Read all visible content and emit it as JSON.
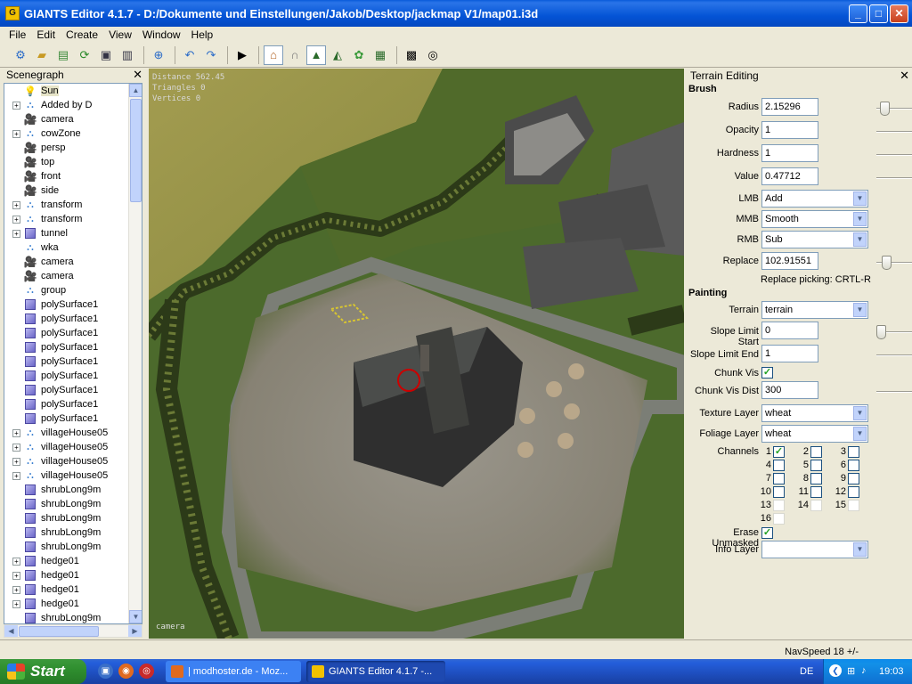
{
  "window": {
    "title": "GIANTS Editor 4.1.7 - D:/Dokumente und Einstellungen/Jakob/Desktop/jackmap V1/map01.i3d",
    "minimize": "_",
    "maximize": "□",
    "close": "✕"
  },
  "menu": [
    "File",
    "Edit",
    "Create",
    "View",
    "Window",
    "Help"
  ],
  "toolbar": {
    "icons": [
      "settings-icon",
      "open-icon",
      "import-icon",
      "refresh-icon",
      "save-icon",
      "export-icon",
      "add-node-icon",
      "undo-icon",
      "redo-icon",
      "play-icon",
      "select-icon",
      "move-icon",
      "terrain-sculpt-icon",
      "terrain-paint-icon",
      "foliage-paint-icon",
      "terrain-info-icon",
      "checker-icon",
      "target-icon"
    ]
  },
  "scenegraph": {
    "title": "Scenegraph",
    "close": "✕",
    "nodes": [
      {
        "label": "Sun",
        "icon": "light",
        "expander": false,
        "selected": true
      },
      {
        "label": "Added by D",
        "icon": "group",
        "expander": true
      },
      {
        "label": "camera",
        "icon": "camera",
        "expander": false
      },
      {
        "label": "cowZone",
        "icon": "group",
        "expander": true
      },
      {
        "label": "persp",
        "icon": "camera",
        "expander": false
      },
      {
        "label": "top",
        "icon": "camera",
        "expander": false
      },
      {
        "label": "front",
        "icon": "camera",
        "expander": false
      },
      {
        "label": "side",
        "icon": "camera",
        "expander": false
      },
      {
        "label": "transform",
        "icon": "group",
        "expander": true
      },
      {
        "label": "transform",
        "icon": "group",
        "expander": true
      },
      {
        "label": "tunnel",
        "icon": "shape",
        "expander": true
      },
      {
        "label": "wka",
        "icon": "group",
        "expander": false
      },
      {
        "label": "camera",
        "icon": "camera",
        "expander": false
      },
      {
        "label": "camera",
        "icon": "camera",
        "expander": false
      },
      {
        "label": "group",
        "icon": "group",
        "expander": false
      },
      {
        "label": "polySurface1",
        "icon": "shape",
        "expander": false
      },
      {
        "label": "polySurface1",
        "icon": "shape",
        "expander": false
      },
      {
        "label": "polySurface1",
        "icon": "shape",
        "expander": false
      },
      {
        "label": "polySurface1",
        "icon": "shape",
        "expander": false
      },
      {
        "label": "polySurface1",
        "icon": "shape",
        "expander": false
      },
      {
        "label": "polySurface1",
        "icon": "shape",
        "expander": false
      },
      {
        "label": "polySurface1",
        "icon": "shape",
        "expander": false
      },
      {
        "label": "polySurface1",
        "icon": "shape",
        "expander": false
      },
      {
        "label": "polySurface1",
        "icon": "shape",
        "expander": false
      },
      {
        "label": "villageHouse05",
        "icon": "group",
        "expander": true
      },
      {
        "label": "villageHouse05",
        "icon": "group",
        "expander": true
      },
      {
        "label": "villageHouse05",
        "icon": "group",
        "expander": true
      },
      {
        "label": "villageHouse05",
        "icon": "group",
        "expander": true
      },
      {
        "label": "shrubLong9m",
        "icon": "shape",
        "expander": false
      },
      {
        "label": "shrubLong9m",
        "icon": "shape",
        "expander": false
      },
      {
        "label": "shrubLong9m",
        "icon": "shape",
        "expander": false
      },
      {
        "label": "shrubLong9m",
        "icon": "shape",
        "expander": false
      },
      {
        "label": "shrubLong9m",
        "icon": "shape",
        "expander": false
      },
      {
        "label": "hedge01",
        "icon": "shape",
        "expander": true
      },
      {
        "label": "hedge01",
        "icon": "shape",
        "expander": true
      },
      {
        "label": "hedge01",
        "icon": "shape",
        "expander": true
      },
      {
        "label": "hedge01",
        "icon": "shape",
        "expander": true
      },
      {
        "label": "shrubLong9m",
        "icon": "shape",
        "expander": false
      }
    ]
  },
  "viewport": {
    "stats": [
      "Distance 562.45",
      "Triangles 0",
      "Vertices 0"
    ],
    "camera_label": "camera"
  },
  "terrain": {
    "title": "Terrain Editing",
    "close": "✕",
    "brush_heading": "Brush",
    "radius_label": "Radius",
    "radius": "2.15296",
    "opacity_label": "Opacity",
    "opacity": "1",
    "hardness_label": "Hardness",
    "hardness": "1",
    "value_label": "Value",
    "value": "0.47712",
    "lmb_label": "LMB",
    "lmb": "Add",
    "mmb_label": "MMB",
    "mmb": "Smooth",
    "rmb_label": "RMB",
    "rmb": "Sub",
    "replace_label": "Replace",
    "replace": "102.91551",
    "replace_picking": "Replace picking: CRTL-R",
    "painting_heading": "Painting",
    "terrain_label": "Terrain",
    "terrain": "terrain",
    "slope_start_label": "Slope Limit Start",
    "slope_start": "0",
    "slope_end_label": "Slope Limit End",
    "slope_end": "1",
    "chunk_vis_label": "Chunk Vis",
    "chunk_vis": true,
    "chunk_vis_dist_label": "Chunk Vis Dist",
    "chunk_vis_dist": "300",
    "texture_layer_label": "Texture Layer",
    "texture_layer": "wheat",
    "foliage_layer_label": "Foliage Layer",
    "foliage_layer": "wheat",
    "channels_label": "Channels",
    "channels": [
      {
        "n": "1",
        "checked": true
      },
      {
        "n": "2",
        "checked": false
      },
      {
        "n": "3",
        "checked": false
      },
      {
        "n": "4",
        "checked": false
      },
      {
        "n": "5",
        "checked": false
      },
      {
        "n": "6",
        "checked": false
      },
      {
        "n": "7",
        "checked": false
      },
      {
        "n": "8",
        "checked": false
      },
      {
        "n": "9",
        "checked": false
      },
      {
        "n": "10",
        "checked": false
      },
      {
        "n": "11",
        "checked": false
      },
      {
        "n": "12",
        "checked": false
      },
      {
        "n": "13",
        "checked": false
      },
      {
        "n": "14",
        "checked": false
      },
      {
        "n": "15",
        "checked": false
      },
      {
        "n": "16",
        "checked": false
      }
    ],
    "erase_unmasked_label": "Erase Unmasked",
    "erase_unmasked": true,
    "info_layer_label": "Info Layer",
    "info_layer": "",
    "radius_slider_fraction": 0.2,
    "replace_slider_fraction": 0.2,
    "slope_slider_fraction": 0.0
  },
  "status": {
    "navspeed": "NavSpeed 18 +/-"
  },
  "taskbar": {
    "start": "Start",
    "tasks": [
      "| modhoster.de - Moz...",
      "GIANTS Editor 4.1.7 -..."
    ],
    "language": "DE",
    "clock": "19:03"
  }
}
